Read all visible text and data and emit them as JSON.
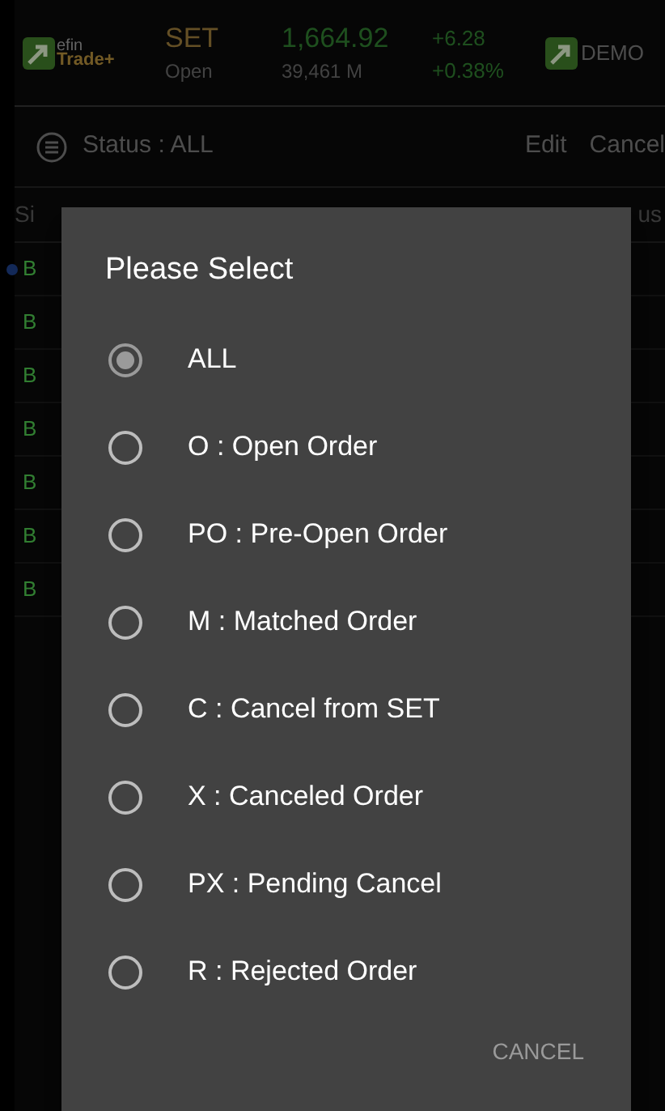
{
  "header": {
    "logo": {
      "line1": "efin",
      "line2": "Trade+"
    },
    "market": "SET",
    "session": "Open",
    "index": "1,664.92",
    "volume": "39,461 M",
    "change": "+6.28",
    "change_pct": "+0.38%",
    "mode": "DEMO"
  },
  "toolbar": {
    "status": "Status : ALL",
    "actions": [
      "Edit",
      "Cancel"
    ]
  },
  "list": {
    "columns": [
      "Si",
      "us"
    ],
    "rows": [
      {
        "side": "B",
        "marked": true
      },
      {
        "side": "B",
        "marked": false
      },
      {
        "side": "B",
        "marked": false
      },
      {
        "side": "B",
        "marked": false
      },
      {
        "side": "B",
        "marked": false
      },
      {
        "side": "B",
        "marked": false
      },
      {
        "side": "B",
        "marked": false
      }
    ]
  },
  "dialog": {
    "title": "Please Select",
    "options": [
      {
        "label": "ALL",
        "selected": true
      },
      {
        "label": "O : Open Order",
        "selected": false
      },
      {
        "label": "PO : Pre-Open Order",
        "selected": false
      },
      {
        "label": "M : Matched Order",
        "selected": false
      },
      {
        "label": "C : Cancel from SET",
        "selected": false
      },
      {
        "label": "X : Canceled Order",
        "selected": false
      },
      {
        "label": "PX : Pending Cancel",
        "selected": false
      },
      {
        "label": "R : Rejected Order",
        "selected": false
      }
    ],
    "button": "CANCEL"
  }
}
